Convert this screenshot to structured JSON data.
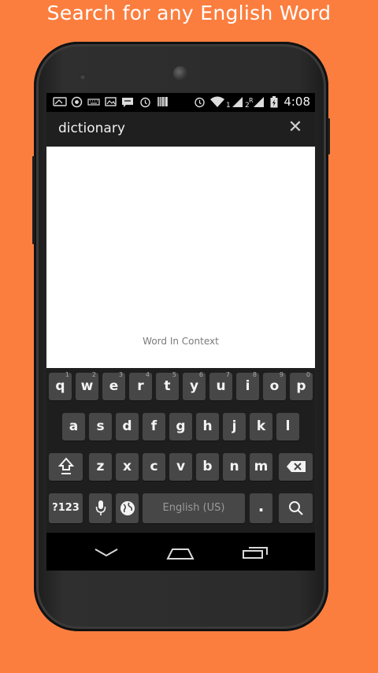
{
  "headline": "Search for any English Word",
  "status_bar": {
    "time": "4:08",
    "icons": [
      "gallery-icon",
      "whatsapp-icon",
      "keyboard-icon",
      "image-icon",
      "chat-icon",
      "alarm-icon",
      "barcode-icon",
      "alarm-icon",
      "wifi-icon",
      "signal-icon",
      "signal-icon",
      "battery-icon"
    ],
    "signal_label_1": "1",
    "signal_label_2": "2",
    "roaming": "R"
  },
  "search": {
    "query": "dictionary",
    "close_icon": "close-icon"
  },
  "content": {
    "word_in_context": "Word In Context"
  },
  "keyboard": {
    "row1": [
      {
        "k": "q",
        "h": "1"
      },
      {
        "k": "w",
        "h": "2"
      },
      {
        "k": "e",
        "h": "3"
      },
      {
        "k": "r",
        "h": "4"
      },
      {
        "k": "t",
        "h": "5"
      },
      {
        "k": "y",
        "h": "6"
      },
      {
        "k": "u",
        "h": "7"
      },
      {
        "k": "i",
        "h": "8"
      },
      {
        "k": "o",
        "h": "9"
      },
      {
        "k": "p",
        "h": "0"
      }
    ],
    "row2": [
      "a",
      "s",
      "d",
      "f",
      "g",
      "h",
      "j",
      "k",
      "l"
    ],
    "row3": [
      "z",
      "x",
      "c",
      "v",
      "b",
      "n",
      "m"
    ],
    "symbols_label": "?123",
    "space_label": "English (US)",
    "period_label": ".",
    "icons": {
      "shift": "shift-icon",
      "backspace": "backspace-icon",
      "mic": "mic-icon",
      "globe": "globe-icon",
      "search": "search-icon"
    }
  },
  "nav": {
    "back": "back-icon",
    "home": "home-icon",
    "recents": "recents-icon"
  },
  "colors": {
    "background": "#fb7e3f",
    "key": "#474747",
    "keyboard": "#1e1e1e"
  }
}
